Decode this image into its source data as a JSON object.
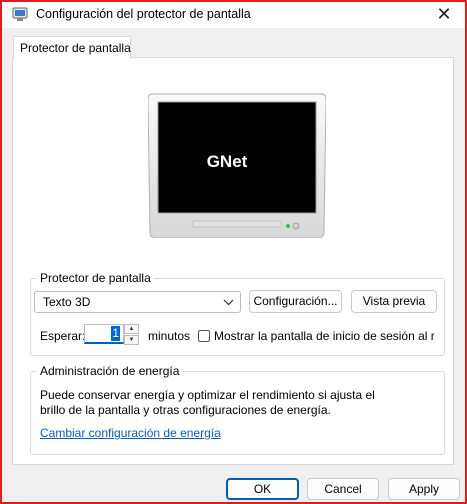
{
  "window": {
    "title": "Configuración del protector de pantalla",
    "close_glyph": "✕"
  },
  "tabs": [
    {
      "label": "Protector de pantalla"
    }
  ],
  "preview": {
    "text": "GNet"
  },
  "screensaver_group": {
    "legend": "Protector de pantalla",
    "selected_screensaver": "Texto 3D",
    "settings_button": "Configuración...",
    "preview_button": "Vista previa",
    "wait_label": "Esperar:",
    "wait_value": "1",
    "minutes_label": "minutos",
    "show_logon_label": "Mostrar la pantalla de inicio de sesión al re"
  },
  "power_group": {
    "legend": "Administración de energía",
    "description_line1": "Puede conservar energía y optimizar el rendimiento si ajusta el",
    "description_line2": "brillo de la pantalla y otras configuraciones de energía.",
    "link": "Cambiar configuración de energía"
  },
  "buttons": {
    "ok": "OK",
    "cancel": "Cancel",
    "apply": "Apply"
  },
  "colors": {
    "accent": "#005fb8",
    "window_border": "#e31d1d",
    "link": "#0a5fb7"
  },
  "icons": [
    "screen-saver-app-icon",
    "close-icon",
    "chevron-down-icon",
    "spin-up-icon",
    "spin-down-icon"
  ]
}
